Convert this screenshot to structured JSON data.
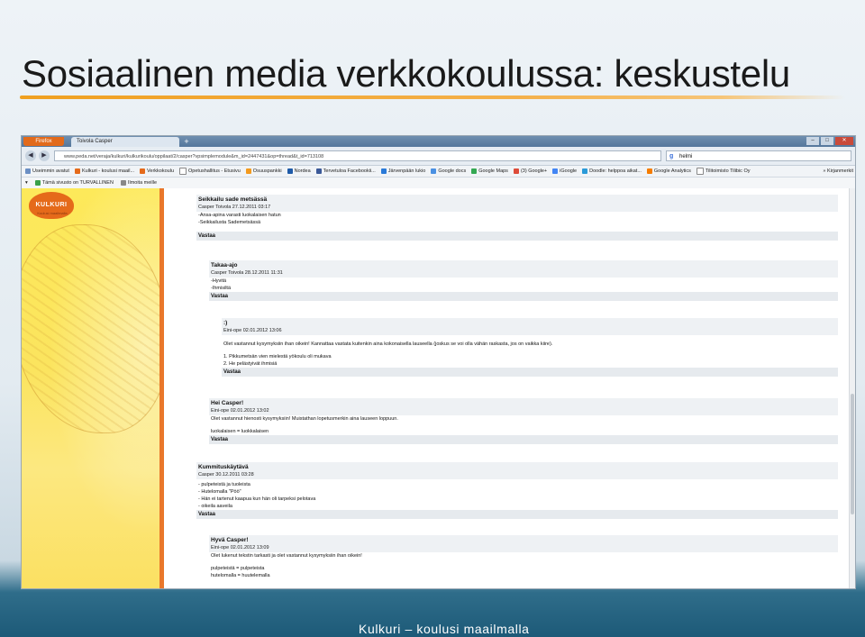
{
  "slide": {
    "title": "Sosiaalinen media verkkokoulussa: keskustelu",
    "footer": "Kulkuri – koulusi maailmalla"
  },
  "browser": {
    "app_button": "Firefox",
    "tab_title": "Toivola Casper",
    "new_tab": "+",
    "url": "www.peda.net/veraja/kulkuri/kulkurikoulu/oppilaat/2/casper?vpsimplemodule&m_id=2447431&op=thread&t_id=713108",
    "search_value": "helmi",
    "bookmarks": [
      "Useimmin avatut",
      "Kulkuri - koulusi maail...",
      "Verkkokoulu",
      "Opetushallitus - Etusivu",
      "Osuuspankki",
      "Nordea",
      "Tervetuloa Facebookii...",
      "Järvenpään lukio",
      "Google docs",
      "Google Maps",
      "(3) Google+",
      "iGoogle",
      "Doodle: helppoa aikat...",
      "Google Analytics",
      "Tilitoimisto Tilibic Oy"
    ],
    "bookmarks_more": "» Kirjanmerkit",
    "toolbar_items": [
      "Tämä sivusto on TURVALLINEN",
      "Ilmoita meille"
    ],
    "logo_text": "KULKURI",
    "logo_sub": "Koulusi maailmalla"
  },
  "posts": [
    {
      "title": "Seikkailu sade metsässä",
      "meta": "Casper Toivola 27.12.2011 03:17",
      "lines": [
        "-Ansa-apina varasti luokalaisen hatun",
        "-Seikkailusta Sademetsässä"
      ],
      "reply": "Vastaa"
    },
    {
      "title": "Takaa-ajo",
      "meta": "Casper Toivola 28.12.2011 11:31",
      "lines": [
        "-Hyvitä",
        "-Ihmisiltä"
      ],
      "reply": "Vastaa"
    },
    {
      "title": ":)",
      "meta": "Eini-ope 02.01.2012 13:06",
      "lines": [
        "Olet vastannut kysymyksiin ihan oikein! Kannattaa vastata kuitenkin aina kokonaisella lauseella (joskus se voi olla vähän raskasta, jos on vaikka kiire).",
        "",
        "1.  Pikkumetsän vien mielestä yökoulu oli mukava",
        "2.  He pelästyivät ihmisiä"
      ],
      "reply": "Vastaa"
    },
    {
      "title": "Hei Casper!",
      "meta": "Eini-ope 02.01.2012 13:02",
      "lines": [
        "Olet vastannut hienosti kysymyksiin! Muistathan lopetusmerkin aina lauseen loppuun.",
        "",
        "luokalaisen = luokkalaisen"
      ],
      "reply": "Vastaa"
    },
    {
      "title": "Kummituskäytävä",
      "meta": "Casper 30.12.2011 03:28",
      "lines": [
        "- pulpeteistä ja tuoleista",
        "- Hutelomalla \"Pöö\"",
        "- Hän ei tartenut kaapua kun hän oli tarpeksi pelotava",
        "- oikeila aaveila"
      ],
      "reply": "Vastaa"
    },
    {
      "title": "Hyvä Casper!",
      "meta": "Eini-ope 02.01.2012 13:09",
      "lines": [
        "Olet lukenut tekstin tarkasti ja olet vastannut kysymyksiin ihan oikein!",
        "",
        "pulpeteistä = pulpeteista",
        "hutelomalla = huutelemalla"
      ],
      "reply": ""
    }
  ],
  "colors": {
    "accent": "#f0a020",
    "panel": "#fde95a",
    "orange": "#e9772a",
    "footer_band": "#1d5a78"
  }
}
